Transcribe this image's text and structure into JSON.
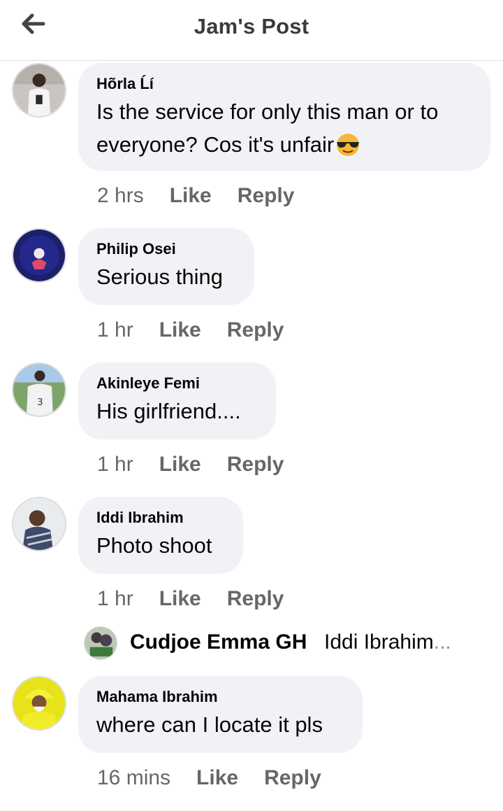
{
  "header": {
    "title": "Jam's Post",
    "back_icon": "arrow-left-icon"
  },
  "comments": [
    {
      "author": "Hõrla Ĺí",
      "lines": [
        "Is the service for only this man or to",
        "everyone? Cos it's unfair"
      ],
      "emoji": "sunglasses-emoji",
      "time": "2 hrs",
      "like": "Like",
      "reply": "Reply"
    },
    {
      "author": "Philip Osei",
      "lines": [
        "Serious thing"
      ],
      "time": "1 hr",
      "like": "Like",
      "reply": "Reply"
    },
    {
      "author": "Akinleye Femi",
      "lines": [
        "His girlfriend...."
      ],
      "time": "1 hr",
      "like": "Like",
      "reply": "Reply"
    },
    {
      "author": "Iddi Ibrahim",
      "lines": [
        "Photo shoot"
      ],
      "time": "1 hr",
      "like": "Like",
      "reply": "Reply"
    },
    {
      "author": "Mahama Ibrahim",
      "lines": [
        "where can I locate it pls"
      ],
      "time": "16 mins",
      "like": "Like",
      "reply": "Reply"
    }
  ],
  "reply_preview": {
    "author": "Cudjoe Emma GH",
    "snippet": "Iddi Ibrahim",
    "ellipsis": "..."
  },
  "colors": {
    "bubble": "#f0f2f5",
    "meta_text": "#65676b",
    "divider": "#dadde1"
  }
}
